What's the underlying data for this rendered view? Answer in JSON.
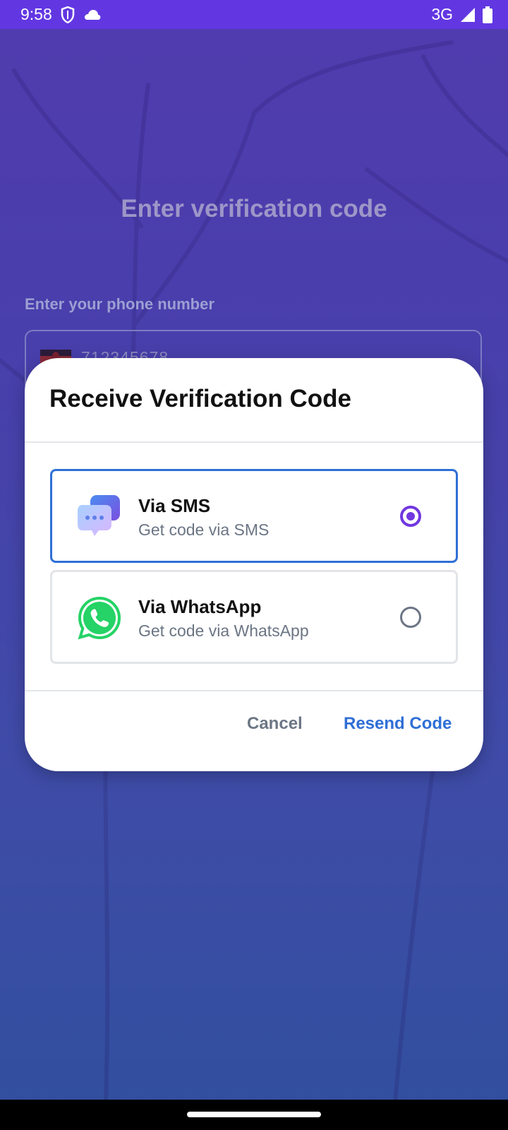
{
  "status_bar": {
    "time": "9:58",
    "network": "3G",
    "icons": [
      "shield-icon",
      "cloud-icon",
      "signal-icon",
      "battery-icon"
    ]
  },
  "background_page": {
    "title": "Enter verification code",
    "phone_label": "Enter your phone number",
    "phone_value": "712345678",
    "flag": "kenya-flag-icon"
  },
  "dialog": {
    "title": "Receive Verification Code",
    "options": [
      {
        "title": "Via SMS",
        "subtitle": "Get code via SMS",
        "icon": "sms-chat-icon",
        "selected": true
      },
      {
        "title": "Via WhatsApp",
        "subtitle": "Get code via WhatsApp",
        "icon": "whatsapp-icon",
        "selected": false
      }
    ],
    "cancel_label": "Cancel",
    "resend_label": "Resend Code"
  },
  "colors": {
    "status_bar": "#6237e2",
    "accent_blue": "#2f6fd6",
    "radio_purple": "#7137e0",
    "whatsapp_green": "#25d366"
  }
}
